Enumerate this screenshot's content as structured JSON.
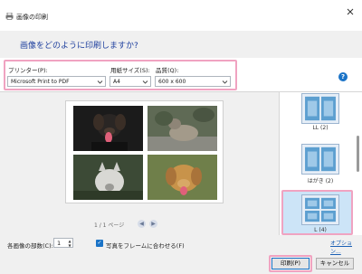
{
  "window": {
    "title": "画像の印刷",
    "question": "画像をどのように印刷しますか?"
  },
  "options": {
    "printer_label": "プリンター(P):",
    "printer_value": "Microsoft Print to PDF",
    "paper_label": "用紙サイズ(S):",
    "paper_value": "A4",
    "quality_label": "品質(Q):",
    "quality_value": "600 x 600"
  },
  "preview": {
    "page_indicator": "1 / 1 ページ"
  },
  "layouts": [
    {
      "label": "LL (2)"
    },
    {
      "label": "はがき (2)"
    },
    {
      "label": "L (4)",
      "selected": true
    }
  ],
  "bottom": {
    "copies_label": "各画像の部数(C):",
    "copies_value": "1",
    "fit_label": "写真をフレームに合わせる(F)",
    "fit_checked": true,
    "options_link": "オプション...",
    "print_button": "印刷(P)",
    "cancel_button": "キャンセル"
  },
  "colors": {
    "highlight": "#f0a3c1",
    "accent": "#1a73c7",
    "heading": "#1e3f9e"
  }
}
